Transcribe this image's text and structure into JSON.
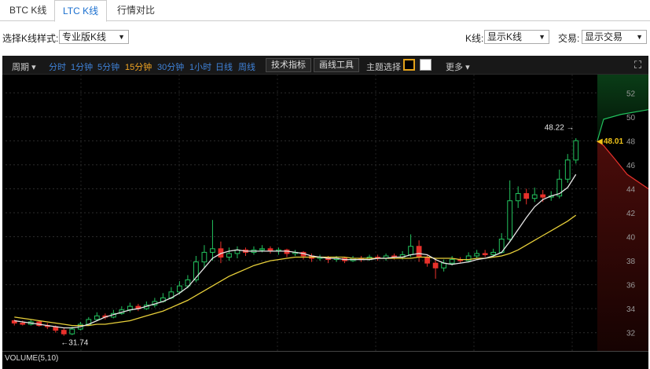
{
  "tabs": [
    {
      "label": "BTC K线",
      "active": false
    },
    {
      "label": "LTC K线",
      "active": true
    },
    {
      "label": "行情对比",
      "active": false
    }
  ],
  "options": {
    "style_label": "选择K线样式:",
    "style_value": "专业版K线",
    "kline_label": "K线:",
    "kline_value": "显示K线",
    "trade_label": "交易:",
    "trade_value": "显示交易"
  },
  "toolbar": {
    "period_label": "周期",
    "periods": [
      "分时",
      "1分钟",
      "5分钟",
      "15分钟",
      "30分钟",
      "1小时",
      "日线",
      "周线"
    ],
    "active_period": "15分钟",
    "indicator_button": "技术指标",
    "draw_button": "画线工具",
    "theme_label": "主题选择",
    "more_label": "更多"
  },
  "colors": {
    "up": "#22c35e",
    "down": "#e8312b",
    "ma_fast": "#e6e6e6",
    "ma_slow": "#e8d03a",
    "price_tag": "#f0c419",
    "theme_dark": "#000000",
    "theme_light": "#ffffff",
    "active_period": "#f2a523",
    "period_link": "#3f82d8"
  },
  "icons": {
    "fullscreen": "fullscreen-icon",
    "dropdown": "dropdown-arrow-icon"
  },
  "chart_data": {
    "type": "candlestick",
    "price_axis_ticks": [
      32,
      34,
      36,
      38,
      40,
      42,
      44,
      46,
      48,
      50,
      52
    ],
    "ylim": [
      31,
      53
    ],
    "current_price": "48.01",
    "last_high_label": "48.22",
    "low_label": "31.74",
    "volume_label": "VOLUME(5,10)",
    "grid": true,
    "candles": [
      [
        33.0,
        32.8,
        32.6,
        33.1
      ],
      [
        32.8,
        32.7,
        32.6,
        33.0
      ],
      [
        32.7,
        32.9,
        32.6,
        33.1
      ],
      [
        32.9,
        32.6,
        32.5,
        33.0
      ],
      [
        32.6,
        32.5,
        32.3,
        32.8
      ],
      [
        32.5,
        32.2,
        32.0,
        32.6
      ],
      [
        32.2,
        31.9,
        31.74,
        32.4
      ],
      [
        31.9,
        32.3,
        31.8,
        32.5
      ],
      [
        32.3,
        32.7,
        32.2,
        32.9
      ],
      [
        32.7,
        33.1,
        32.6,
        33.3
      ],
      [
        33.1,
        33.4,
        33.0,
        33.7
      ],
      [
        33.4,
        33.3,
        33.1,
        33.6
      ],
      [
        33.3,
        33.6,
        33.2,
        33.9
      ],
      [
        33.6,
        33.9,
        33.5,
        34.2
      ],
      [
        33.9,
        34.2,
        33.7,
        34.5
      ],
      [
        34.2,
        34.0,
        33.8,
        34.4
      ],
      [
        34.0,
        34.3,
        33.9,
        34.6
      ],
      [
        34.3,
        34.6,
        34.1,
        34.9
      ],
      [
        34.6,
        34.9,
        34.5,
        35.3
      ],
      [
        34.9,
        35.4,
        34.8,
        35.8
      ],
      [
        35.4,
        35.9,
        35.2,
        36.3
      ],
      [
        35.9,
        36.4,
        35.7,
        36.8
      ],
      [
        36.4,
        37.9,
        36.2,
        38.4
      ],
      [
        37.9,
        38.7,
        37.4,
        39.3
      ],
      [
        38.7,
        39.0,
        38.0,
        41.4
      ],
      [
        39.0,
        38.3,
        37.8,
        39.6
      ],
      [
        38.3,
        38.6,
        38.0,
        39.1
      ],
      [
        38.6,
        38.9,
        38.2,
        39.2
      ],
      [
        38.9,
        38.7,
        38.4,
        39.1
      ],
      [
        38.7,
        38.9,
        38.5,
        39.2
      ],
      [
        38.9,
        39.0,
        38.7,
        39.3
      ],
      [
        39.0,
        38.8,
        38.6,
        39.2
      ],
      [
        38.8,
        38.9,
        38.5,
        39.1
      ],
      [
        38.9,
        38.6,
        38.3,
        39.0
      ],
      [
        38.6,
        38.7,
        38.4,
        38.9
      ],
      [
        38.7,
        38.4,
        38.1,
        38.8
      ],
      [
        38.4,
        38.2,
        37.9,
        38.6
      ],
      [
        38.2,
        38.3,
        38.0,
        38.5
      ],
      [
        38.3,
        38.1,
        37.8,
        38.4
      ],
      [
        38.1,
        38.2,
        37.9,
        38.4
      ],
      [
        38.2,
        38.0,
        37.8,
        38.3
      ],
      [
        38.0,
        38.2,
        37.9,
        38.4
      ],
      [
        38.2,
        38.1,
        37.9,
        38.4
      ],
      [
        38.1,
        38.3,
        38.0,
        38.5
      ],
      [
        38.3,
        38.2,
        38.0,
        38.5
      ],
      [
        38.2,
        38.4,
        38.0,
        38.6
      ],
      [
        38.4,
        38.3,
        38.1,
        38.6
      ],
      [
        38.3,
        38.5,
        38.1,
        38.8
      ],
      [
        38.5,
        39.2,
        38.3,
        40.2
      ],
      [
        39.2,
        38.3,
        37.9,
        39.7
      ],
      [
        38.3,
        37.8,
        37.5,
        38.5
      ],
      [
        37.8,
        37.4,
        36.5,
        38.2
      ],
      [
        37.4,
        37.8,
        37.1,
        38.1
      ],
      [
        37.8,
        38.1,
        37.6,
        38.4
      ],
      [
        38.1,
        38.0,
        37.8,
        38.3
      ],
      [
        38.0,
        38.4,
        37.9,
        38.7
      ],
      [
        38.4,
        38.6,
        38.2,
        38.9
      ],
      [
        38.6,
        38.5,
        38.3,
        38.9
      ],
      [
        38.5,
        38.7,
        38.3,
        39.0
      ],
      [
        38.7,
        39.8,
        38.6,
        40.3
      ],
      [
        39.8,
        43.0,
        39.6,
        44.7
      ],
      [
        43.0,
        43.6,
        42.4,
        44.2
      ],
      [
        43.6,
        43.2,
        42.7,
        44.0
      ],
      [
        43.2,
        43.5,
        42.9,
        44.1
      ],
      [
        43.5,
        43.3,
        42.9,
        43.9
      ],
      [
        43.3,
        43.4,
        43.0,
        43.8
      ],
      [
        43.4,
        44.8,
        43.2,
        45.6
      ],
      [
        44.8,
        46.4,
        44.5,
        46.9
      ],
      [
        46.4,
        48.01,
        46.1,
        48.22
      ]
    ],
    "ma_fast": [
      33.0,
      32.9,
      32.8,
      32.7,
      32.6,
      32.5,
      32.4,
      32.4,
      32.5,
      32.7,
      33.0,
      33.3,
      33.5,
      33.7,
      33.9,
      34.0,
      34.2,
      34.4,
      34.6,
      34.9,
      35.3,
      35.8,
      36.6,
      37.4,
      38.2,
      38.6,
      38.8,
      38.9,
      38.8,
      38.8,
      38.8,
      38.8,
      38.8,
      38.8,
      38.7,
      38.6,
      38.4,
      38.3,
      38.2,
      38.2,
      38.1,
      38.1,
      38.1,
      38.1,
      38.2,
      38.2,
      38.3,
      38.3,
      38.5,
      38.6,
      38.5,
      38.1,
      37.8,
      37.7,
      37.8,
      37.9,
      38.1,
      38.2,
      38.4,
      38.7,
      39.6,
      40.6,
      41.6,
      42.5,
      43.1,
      43.4,
      43.6,
      44.1,
      45.2
    ],
    "ma_slow": [
      33.3,
      33.2,
      33.1,
      33.0,
      32.9,
      32.8,
      32.7,
      32.6,
      32.6,
      32.6,
      32.7,
      32.7,
      32.8,
      32.9,
      33.0,
      33.2,
      33.4,
      33.6,
      33.8,
      34.1,
      34.4,
      34.7,
      35.1,
      35.5,
      35.9,
      36.3,
      36.7,
      37.0,
      37.3,
      37.6,
      37.8,
      38.0,
      38.1,
      38.2,
      38.3,
      38.3,
      38.3,
      38.3,
      38.3,
      38.3,
      38.3,
      38.2,
      38.2,
      38.2,
      38.2,
      38.2,
      38.2,
      38.2,
      38.2,
      38.3,
      38.3,
      38.2,
      38.2,
      38.2,
      38.1,
      38.1,
      38.2,
      38.2,
      38.3,
      38.4,
      38.6,
      38.9,
      39.3,
      39.7,
      40.1,
      40.5,
      40.9,
      41.3,
      41.8
    ],
    "depth_right": {
      "bids_top": 44.0,
      "asks_top": 50.6
    }
  }
}
